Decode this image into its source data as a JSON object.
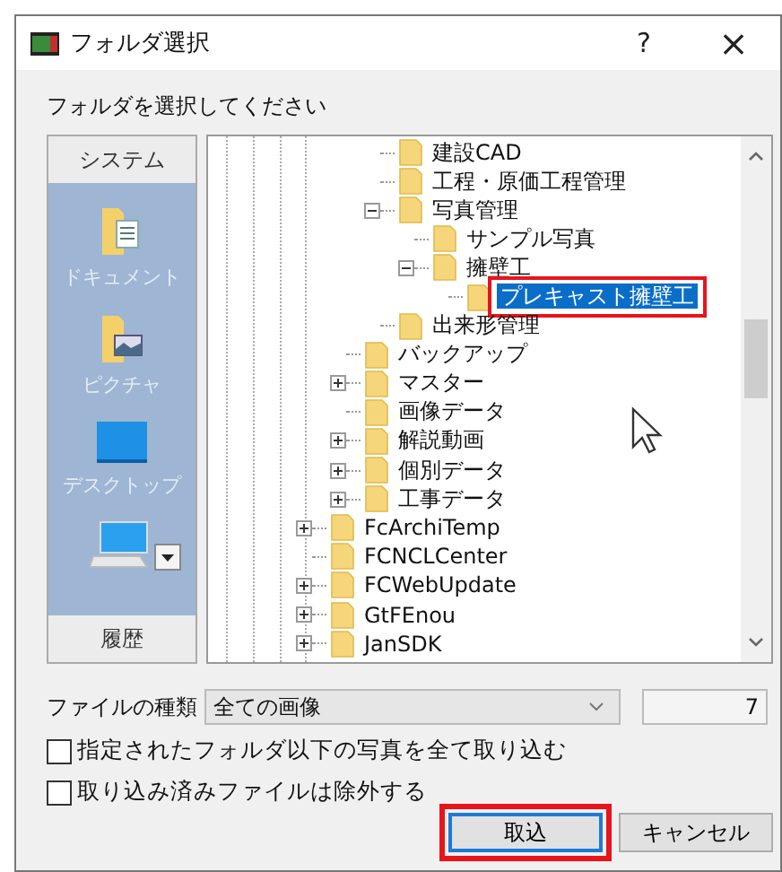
{
  "window": {
    "title": "フォルダ選択",
    "help": "?",
    "close": "×"
  },
  "prompt": "フォルダを選択してください",
  "sidebar": {
    "header": "システム",
    "footer": "履歴",
    "places": [
      {
        "kind": "documents",
        "label": "ドキュメント"
      },
      {
        "kind": "pictures",
        "label": "ピクチャ"
      },
      {
        "kind": "desktop",
        "label": "デスクトップ"
      },
      {
        "kind": "computer"
      }
    ]
  },
  "tree": {
    "items": [
      {
        "children": [
          {
            "children": [
              {
                "children": [
                  {
                    "label": "建設CAD",
                    "selected": false
                  },
                  {
                    "label": "工程・原価工程管理",
                    "selected": false
                  },
                  {
                    "label": "写真管理",
                    "expanded": true,
                    "selected": false,
                    "children": [
                      {
                        "label": "サンプル写真",
                        "selected": false
                      },
                      {
                        "label": "擁壁工",
                        "expanded": true,
                        "selected": false,
                        "children": [
                          {
                            "label": "プレキャスト擁壁工",
                            "selected": true,
                            "highlighted": true
                          }
                        ]
                      }
                    ]
                  },
                  {
                    "label": "出来形管理",
                    "selected": false
                  }
                ]
              },
              {
                "label": "バックアップ",
                "selected": false
              },
              {
                "label": "マスター",
                "expanded": false,
                "selected": false
              },
              {
                "label": "画像データ",
                "selected": false
              },
              {
                "label": "解説動画",
                "expanded": false,
                "selected": false
              },
              {
                "label": "個別データ",
                "expanded": false,
                "selected": false
              },
              {
                "label": "工事データ",
                "expanded": false,
                "selected": false
              }
            ]
          },
          {
            "label": "FcArchiTemp",
            "expanded": false,
            "selected": false
          },
          {
            "label": "FCNCLCenter",
            "selected": false
          },
          {
            "label": "FCWebUpdate",
            "expanded": false,
            "selected": false
          },
          {
            "label": "GtFEnou",
            "expanded": false,
            "selected": false
          },
          {
            "label": "JanSDK",
            "expanded": false,
            "selected": false
          }
        ]
      }
    ]
  },
  "file_type": {
    "label": "ファイルの種類",
    "value": "全ての画像",
    "count": "7"
  },
  "options": [
    {
      "label": "指定されたフォルダ以下の写真を全て取り込む",
      "checked": false
    },
    {
      "label": "取り込み済みファイルは除外する",
      "checked": false
    }
  ],
  "buttons": [
    {
      "label": "取込",
      "default": true,
      "highlighted": true
    },
    {
      "label": "キャンセル",
      "default": false,
      "highlighted": false
    }
  ]
}
